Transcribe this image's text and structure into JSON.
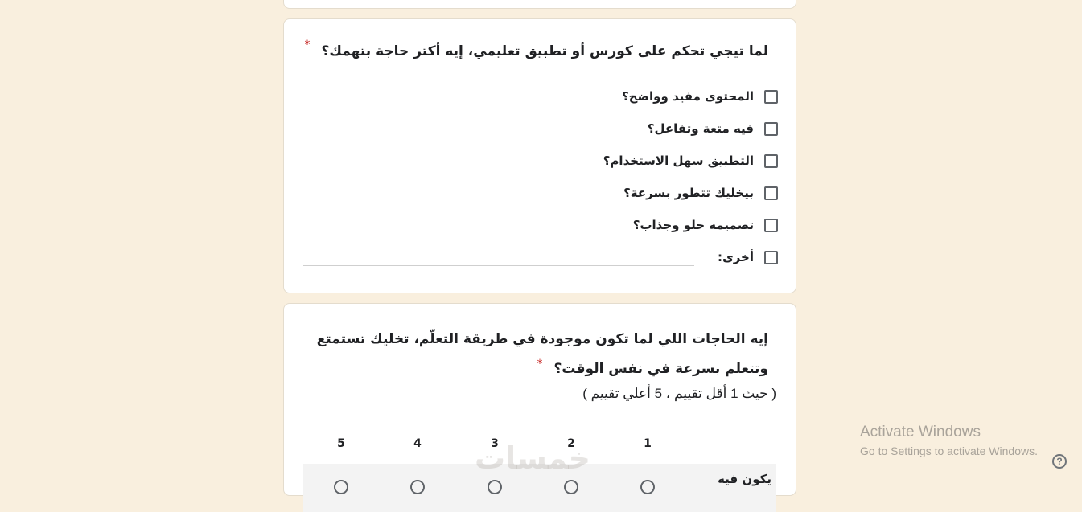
{
  "question1": {
    "title": "لما تيجي تحكم على كورس أو تطبيق تعليمي، إيه أكتر حاجة بتهمك؟",
    "required_mark": "*",
    "options": [
      "المحتوى مفيد وواضح؟",
      "فيه متعة وتفاعل؟",
      "التطبيق سهل الاستخدام؟",
      "بيخليك تتطور بسرعة؟",
      "تصميمه حلو وجذاب؟",
      "أخرى:"
    ]
  },
  "question2": {
    "title": "إيه الحاجات اللي لما تكون موجودة في طريقة التعلّم، تخليك تستمتع وتتعلم بسرعة في نفس الوقت؟",
    "required_mark": "*",
    "subtitle": "( حيث 1 أقل تقييم ، 5 أعلي تقييم )",
    "scale": [
      "1",
      "2",
      "3",
      "4",
      "5"
    ],
    "row_label": "يكون فيه"
  },
  "watermark": "خمسات",
  "windows_activation": {
    "title": "Activate Windows",
    "subtitle": "Go to Settings to activate Windows."
  },
  "help_icon": "?",
  "colors": {
    "background": "#f9efde",
    "card": "#ffffff",
    "required": "#c5221f"
  }
}
